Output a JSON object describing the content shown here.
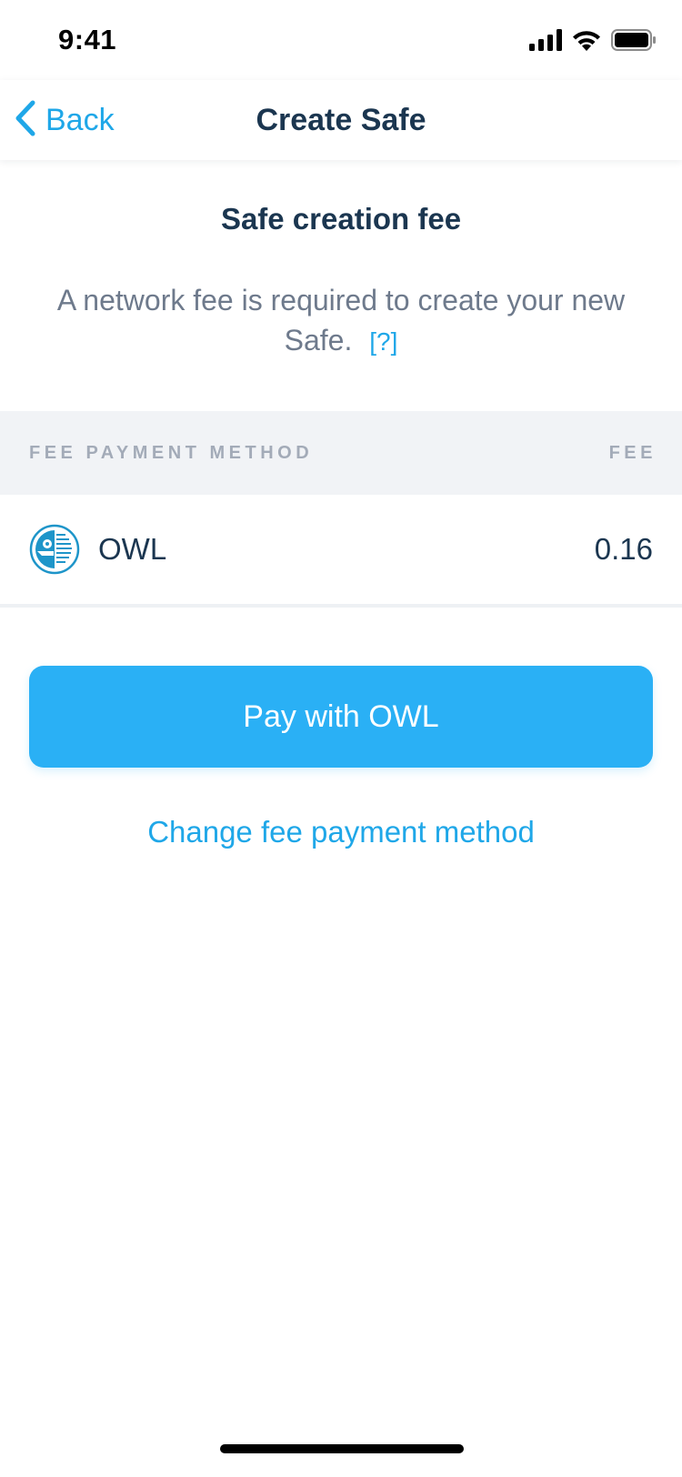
{
  "status_bar": {
    "time": "9:41",
    "icons": [
      "signal-icon",
      "wifi-icon",
      "battery-icon"
    ]
  },
  "nav": {
    "back_label": "Back",
    "title": "Create Safe"
  },
  "intro": {
    "title": "Safe creation fee",
    "description": "A network fee is required to create your new Safe.",
    "help_label": "[?]"
  },
  "fee_table": {
    "header_method": "FEE PAYMENT METHOD",
    "header_fee": "FEE",
    "rows": [
      {
        "token": "OWL",
        "icon": "owl-token-icon",
        "fee": "0.16"
      }
    ]
  },
  "actions": {
    "pay_label": "Pay with OWL",
    "change_method_label": "Change fee payment method"
  },
  "colors": {
    "accent": "#2ab0f5",
    "link": "#1fa7e8",
    "text_dark": "#1b3650",
    "text_muted": "#6e7a8c",
    "header_bg": "#f1f3f6"
  }
}
